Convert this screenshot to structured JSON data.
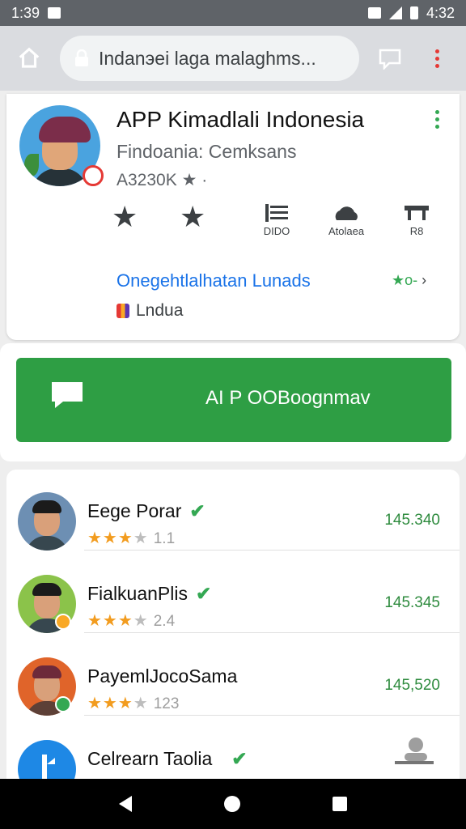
{
  "status_bar": {
    "time_left": "1:39",
    "time_right": "4:32"
  },
  "browser": {
    "url_text": "Indanэei laga malaghms..."
  },
  "app": {
    "title": "APP Kimadlali Indonesia",
    "developer": "Findoania: Cemksans",
    "meta": "A3230K ★ ·",
    "actions": [
      {
        "label": "",
        "icon": "star-icon"
      },
      {
        "label": "",
        "icon": "star-icon"
      },
      {
        "label": "DIDO",
        "icon": "list-icon"
      },
      {
        "label": "Atolaea",
        "icon": "cloud-icon"
      },
      {
        "label": "R8",
        "icon": "desk-icon"
      }
    ],
    "link_text": "Onegehtlalhatan Lunads",
    "link_right": "★o-",
    "tag_text": "Lndua"
  },
  "primary_button": {
    "label": "AI P OOBoognmav"
  },
  "list": [
    {
      "name": "Eege Porar",
      "stars": "★★★★",
      "rating": "1.1",
      "price": "145.340",
      "avatar_bg": "#6d8fb3"
    },
    {
      "name": "FialkuanPlis",
      "stars": "★★★★",
      "rating": "2.4",
      "price": "145.345",
      "avatar_bg": "#8bc34a"
    },
    {
      "name": "PayemlJocoSama",
      "stars": "★★★★",
      "rating": "123",
      "price": "145,520",
      "avatar_bg": "#e0642a"
    },
    {
      "name": "Celrearn Taolia",
      "stars": "★★★",
      "rating": "",
      "price": "",
      "avatar_bg": "#1e88e5"
    }
  ],
  "colors": {
    "accent_green": "#2e9e44",
    "link_blue": "#1a73e8",
    "star_orange": "#f29c1f"
  }
}
